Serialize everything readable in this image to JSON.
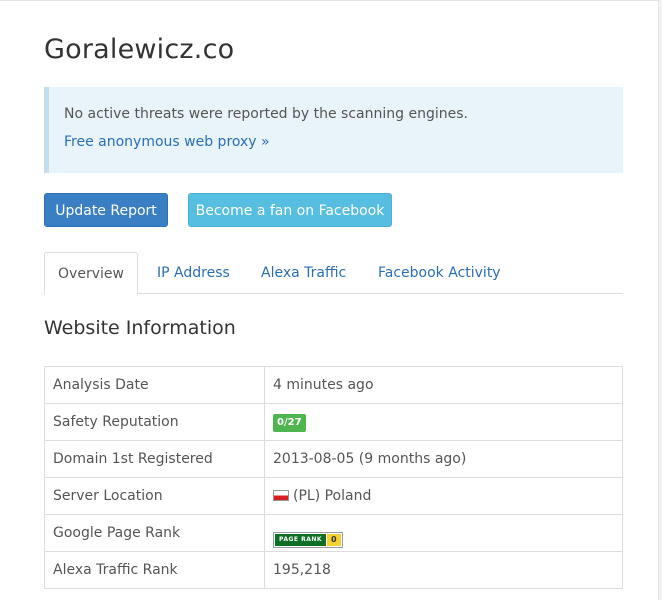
{
  "site": {
    "title": "Goralewicz.co"
  },
  "alert": {
    "message": "No active threats were reported by the scanning engines.",
    "link": "Free anonymous web proxy »"
  },
  "buttons": {
    "update": "Update Report",
    "facebook": "Become a fan on Facebook"
  },
  "tabs": [
    "Overview",
    "IP Address",
    "Alexa Traffic",
    "Facebook Activity"
  ],
  "section": {
    "title": "Website Information"
  },
  "info": {
    "analysis_date": {
      "label": "Analysis Date",
      "value": "4 minutes ago"
    },
    "safety": {
      "label": "Safety Reputation",
      "badge": "0/27",
      "badge_color": "#4fb54f"
    },
    "registered": {
      "label": "Domain 1st Registered",
      "value": "2013-08-05 (9 months ago)"
    },
    "location": {
      "label": "Server Location",
      "value": "(PL) Poland",
      "flag_icon": "poland-flag-icon"
    },
    "pagerank": {
      "label": "Google Page Rank",
      "badge_label": "PAGE RANK",
      "value": "0"
    },
    "alexa": {
      "label": "Alexa Traffic Rank",
      "value": "195,218"
    }
  },
  "colors": {
    "link": "#2a6fb5",
    "primary_button": "#3a7fc4",
    "info_button": "#56bee0",
    "alert_bg": "#e8f3fa"
  }
}
